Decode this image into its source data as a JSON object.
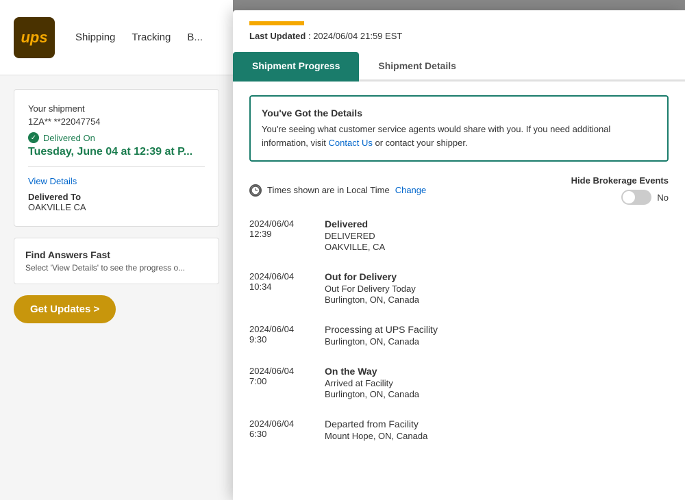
{
  "background": {
    "logo_text": "ups",
    "nav": {
      "items": [
        "Shipping",
        "Tracking",
        "B..."
      ]
    },
    "shipment": {
      "label": "Your shipment",
      "tracking_number": "1ZA**  **22047754",
      "delivered_on_label": "Delivered On",
      "delivery_date": "Tuesday, June 04 at 12:39 at P...",
      "view_details_label": "View Details",
      "delivered_to_label": "Delivered To",
      "delivered_to_value": "OAKVILLE CA"
    },
    "find_answers": {
      "title": "Find Answers Fast",
      "text": "Select 'View Details' to see the progress o..."
    },
    "get_updates_btn": "Get Updates >"
  },
  "panel": {
    "top_bar_color": "#f5a800",
    "last_updated_label": "Last Updated",
    "last_updated_value": "2024/06/04 21:59 EST",
    "tabs": [
      {
        "id": "shipment-progress",
        "label": "Shipment Progress",
        "active": true
      },
      {
        "id": "shipment-details",
        "label": "Shipment Details",
        "active": false
      }
    ],
    "info_box": {
      "title": "You've Got the Details",
      "body": "You're seeing what customer service agents would share with you. If you need additional information, visit ",
      "link_text": "Contact Us",
      "body_after": " or contact your shipper."
    },
    "timezone": {
      "label": "Times shown are in Local Time",
      "change_label": "Change"
    },
    "brokerage": {
      "label": "Hide Brokerage Events",
      "toggle_value": "No"
    },
    "events": [
      {
        "date": "2024/06/04",
        "time": "12:39",
        "title": "Delivered",
        "title_bold": true,
        "subtitle": "DELIVERED",
        "location": "OAKVILLE, CA"
      },
      {
        "date": "2024/06/04",
        "time": "10:34",
        "title": "Out for Delivery",
        "title_bold": true,
        "subtitle": "Out For Delivery Today",
        "location": "Burlington, ON, Canada"
      },
      {
        "date": "2024/06/04",
        "time": "9:30",
        "title": "Processing at UPS Facility",
        "title_bold": false,
        "subtitle": "",
        "location": "Burlington, ON, Canada"
      },
      {
        "date": "2024/06/04",
        "time": "7:00",
        "title": "On the Way",
        "title_bold": true,
        "subtitle": "Arrived at Facility",
        "location": "Burlington, ON, Canada"
      },
      {
        "date": "2024/06/04",
        "time": "6:30",
        "title": "Departed from Facility",
        "title_bold": false,
        "subtitle": "",
        "location": "Mount Hope, ON, Canada"
      }
    ]
  }
}
